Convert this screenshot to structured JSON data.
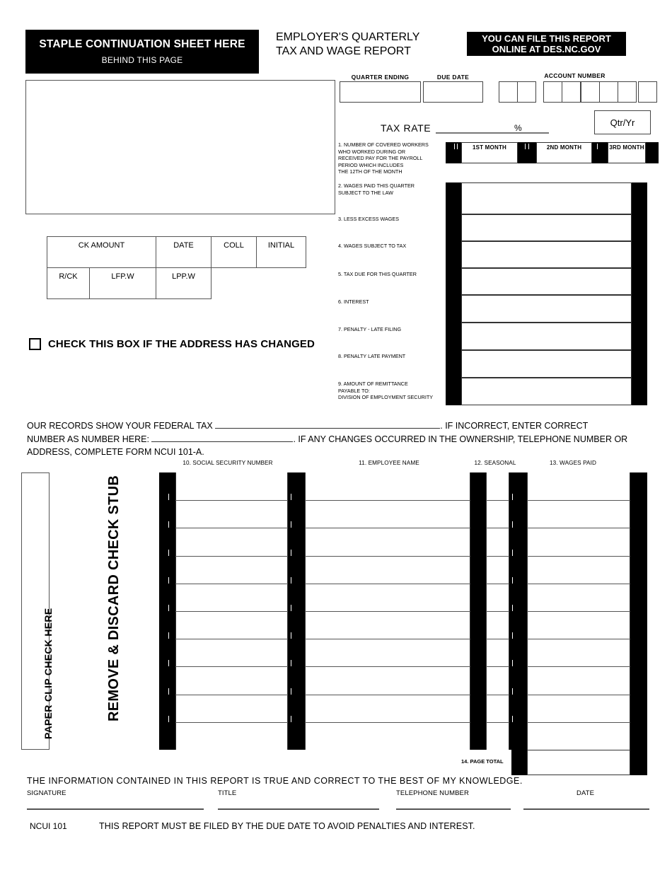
{
  "header": {
    "staple_line1": "STAPLE CONTINUATION SHEET HERE",
    "staple_line2": "BEHIND THIS PAGE",
    "title_line1": "EMPLOYER'S QUARTERLY",
    "title_line2": "TAX AND WAGE REPORT",
    "online_line1": "YOU CAN FILE THIS REPORT",
    "online_line2": "ONLINE AT DES.NC.GOV"
  },
  "fields": {
    "quarter_ending_label": "QUARTER ENDING",
    "quarter_ending_value": "",
    "due_date_label": "DUE DATE",
    "due_date_value": "",
    "account_number_label": "ACCOUNT NUMBER",
    "account_number_digits": [
      "",
      "",
      "",
      "",
      "",
      "",
      "",
      ""
    ],
    "account_groups": [
      2,
      2,
      3,
      1
    ],
    "qtr_yr_label": "Qtr/Yr",
    "qtr_yr_value": "",
    "tax_rate_label": "TAX RATE",
    "tax_rate_value": "",
    "percent_symbol": "%"
  },
  "item1": {
    "label": "1.  NUMBER OF COVERED WORKERS WHO WORKED DURING OR RECEIVED PAY FOR THE PAYROLL PERIOD WHICH INCLUDES THE 12TH OF THE MONTH",
    "label_lines": [
      "1.  NUMBER OF COVERED WORKERS",
      "WHO WORKED DURING OR",
      "RECEIVED PAY FOR THE PAYROLL",
      "PERIOD WHICH INCLUDES",
      "THE 12TH OF THE MONTH"
    ],
    "months": [
      "1ST MONTH",
      "2ND MONTH",
      "3RD MONTH"
    ],
    "month_values": [
      "",
      "",
      ""
    ]
  },
  "line_items": [
    {
      "num": "2",
      "lines": [
        "2. WAGES PAID THIS QUARTER",
        "    SUBJECT TO THE LAW"
      ],
      "value": ""
    },
    {
      "num": "3",
      "lines": [
        "3. LESS EXCESS WAGES"
      ],
      "value": ""
    },
    {
      "num": "4",
      "lines": [
        "4. WAGES SUBJECT TO TAX"
      ],
      "value": ""
    },
    {
      "num": "5",
      "lines": [
        "5. TAX DUE FOR THIS QUARTER"
      ],
      "value": ""
    },
    {
      "num": "6",
      "lines": [
        "6. INTEREST"
      ],
      "value": ""
    },
    {
      "num": "7",
      "lines": [
        "7.  PENALTY - LATE FILING"
      ],
      "value": ""
    },
    {
      "num": "8",
      "lines": [
        "8. PENALTY LATE PAYMENT"
      ],
      "value": ""
    },
    {
      "num": "9",
      "lines": [
        "9. AMOUNT OF REMITTANCE",
        "     PAYABLE TO:",
        "     DIVISION OF EMPLOYMENT SECURITY"
      ],
      "value": ""
    }
  ],
  "ck_table": {
    "row1": [
      "CK AMOUNT",
      "DATE",
      "COLL",
      "INITIAL"
    ],
    "row2": [
      "R/CK",
      "LFP.W",
      "LPP.W"
    ]
  },
  "address_changed": {
    "label": "CHECK THIS BOX IF THE ADDRESS HAS CHANGED",
    "checked": false
  },
  "federal_tax": {
    "seg1": "OUR RECORDS SHOW YOUR FEDERAL TAX",
    "seg2": ". IF INCORRECT, ENTER CORRECT",
    "seg3": "NUMBER AS  NUMBER HERE:",
    "seg4": ". IF ANY CHANGES OCCURRED IN THE OWNERSHIP, TELEPHONE NUMBER OR",
    "seg5": "ADDRESS, COMPLETE FORM NCUI 101-A.",
    "fed_number_value": "",
    "correct_number_value": ""
  },
  "employee_table": {
    "headers": [
      "10.  SOCIAL SECURITY NUMBER",
      "11. EMPLOYEE NAME",
      "12. SEASONAL",
      "13. WAGES PAID"
    ],
    "row_count": 10,
    "rows": [
      {
        "ssn": "",
        "name": "",
        "seasonal": "",
        "wages": ""
      },
      {
        "ssn": "",
        "name": "",
        "seasonal": "",
        "wages": ""
      },
      {
        "ssn": "",
        "name": "",
        "seasonal": "",
        "wages": ""
      },
      {
        "ssn": "",
        "name": "",
        "seasonal": "",
        "wages": ""
      },
      {
        "ssn": "",
        "name": "",
        "seasonal": "",
        "wages": ""
      },
      {
        "ssn": "",
        "name": "",
        "seasonal": "",
        "wages": ""
      },
      {
        "ssn": "",
        "name": "",
        "seasonal": "",
        "wages": ""
      },
      {
        "ssn": "",
        "name": "",
        "seasonal": "",
        "wages": ""
      },
      {
        "ssn": "",
        "name": "",
        "seasonal": "",
        "wages": ""
      },
      {
        "ssn": "",
        "name": "",
        "seasonal": "",
        "wages": ""
      }
    ],
    "page_total_label": "14. PAGE TOTAL",
    "page_total_value": ""
  },
  "side_labels": {
    "paper_clip": "PAPER CLIP CHECK HERE",
    "remove_discard": "REMOVE  &  DISCARD CHECK STUB"
  },
  "footer": {
    "truth_statement": "THE  INFORMATION  CONTAINED  IN  THIS  REPORT  IS  TRUE  AND  CORRECT  TO  THE  BEST  OF  MY  KNOWLEDGE.",
    "signature_label": "SIGNATURE",
    "title_label": "TITLE",
    "telephone_label": "TELEPHONE NUMBER",
    "date_label": "DATE",
    "signature_value": "",
    "title_value": "",
    "telephone_value": "",
    "date_value": "",
    "form_code": "NCUI 101",
    "notice": "THIS REPORT MUST BE FILED BY THE DUE DATE TO AVOID PENALTIES AND INTEREST."
  }
}
